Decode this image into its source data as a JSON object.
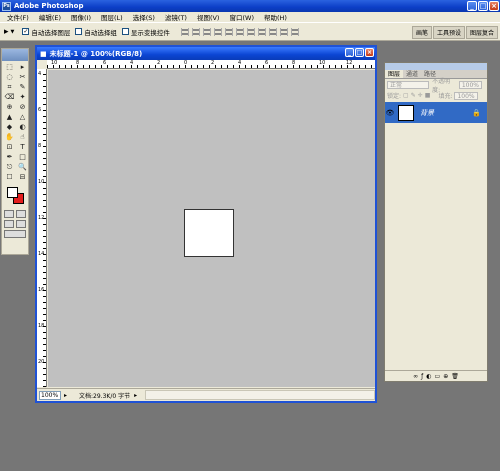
{
  "app": {
    "title": "Adobe Photoshop",
    "logo": "Ps"
  },
  "window_controls": {
    "minimize": "_",
    "maximize": "□",
    "close": "×"
  },
  "menu": [
    "文件(F)",
    "编辑(E)",
    "图像(I)",
    "图层(L)",
    "选择(S)",
    "滤镜(T)",
    "视图(V)",
    "窗口(W)",
    "帮助(H)"
  ],
  "options": {
    "tool_icon": "▸",
    "auto_select_layer": "自动选择图层",
    "auto_select_group": "自动选择组",
    "show_transform": "显示变换控件",
    "auto_select_layer_checked": true
  },
  "palette_well": [
    "画笔",
    "工具预设",
    "图层复合"
  ],
  "tools": [
    "⬚",
    "▸",
    "◌",
    "✂",
    "⌗",
    "✎",
    "⌫",
    "✦",
    "⊕",
    "⊘",
    "▲",
    "△",
    "◆",
    "◐",
    "✋",
    "☝",
    "⊡",
    "T",
    "✒",
    "□",
    "⎋",
    "🔍",
    "☐",
    "⊟"
  ],
  "colors": {
    "foreground": "#ffffff",
    "background": "#e31d1d",
    "accent": "#316ac5"
  },
  "document": {
    "title": "未标题-1 @ 100%(RGB/8)",
    "ruler_h": [
      "10",
      "8",
      "6",
      "4",
      "2",
      "0",
      "2",
      "4",
      "6",
      "8",
      "10",
      "12"
    ],
    "ruler_v": [
      "4",
      "6",
      "8",
      "10",
      "12",
      "14",
      "16",
      "18",
      "20"
    ],
    "zoom": "100%",
    "status": "文档:29.3K/0 字节"
  },
  "layers_panel": {
    "tabs": [
      "图层",
      "通道",
      "路径"
    ],
    "blend_mode": "正常",
    "opacity_label": "不透明度:",
    "opacity": "100%",
    "lock_label": "锁定:",
    "fill_label": "填充:",
    "fill": "100%",
    "layer_name": "背景",
    "footer_icons": [
      "∞",
      "ƒ",
      "◐",
      "▭",
      "⊕",
      "🗑"
    ]
  }
}
